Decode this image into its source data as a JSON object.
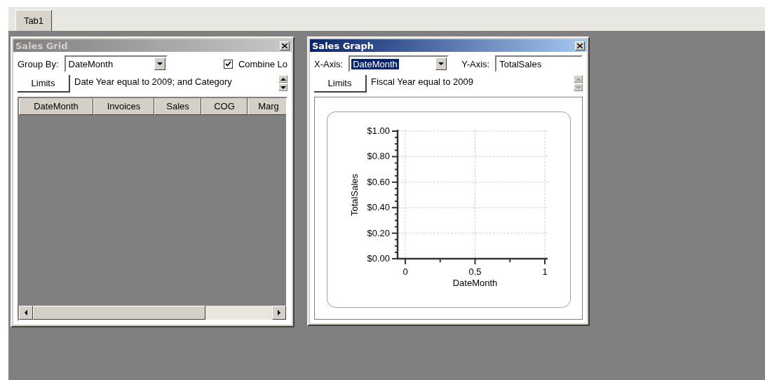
{
  "tabs": [
    {
      "label": "Tab1",
      "selected": true
    }
  ],
  "sales_grid": {
    "title": "Sales Grid",
    "active": false,
    "group_by": {
      "label": "Group By:",
      "value": "DateMonth",
      "focused": false
    },
    "combine": {
      "label": "Combine Lo",
      "checked": true
    },
    "limits": {
      "button": "Limits",
      "text": "Date Year equal to 2009; and Category",
      "disabled": false
    },
    "columns": [
      "DateMonth",
      "Invoices",
      "Sales",
      "COG",
      "Marg"
    ]
  },
  "sales_graph": {
    "title": "Sales Graph",
    "active": true,
    "x_axis": {
      "label": "X-Axis:",
      "value": "DateMonth",
      "focused": true
    },
    "y_axis": {
      "label": "Y-Axis:",
      "value": "TotalSales"
    },
    "limits": {
      "button": "Limits",
      "text": "Fiscal Year equal to 2009",
      "disabled": true
    },
    "chart_data": {
      "type": "line",
      "grid": true,
      "xlabel": "DateMonth",
      "ylabel": "TotalSales",
      "xlim": [
        0,
        1
      ],
      "ylim": [
        0,
        1
      ],
      "xticks": [
        0,
        0.5,
        1
      ],
      "yticks": [
        {
          "value": 0,
          "label": "$0.00"
        },
        {
          "value": 0.2,
          "label": "$0.20"
        },
        {
          "value": 0.4,
          "label": "$0.40"
        },
        {
          "value": 0.6,
          "label": "$0.60"
        },
        {
          "value": 0.8,
          "label": "$0.80"
        },
        {
          "value": 1,
          "label": "$1.00"
        }
      ]
    }
  }
}
